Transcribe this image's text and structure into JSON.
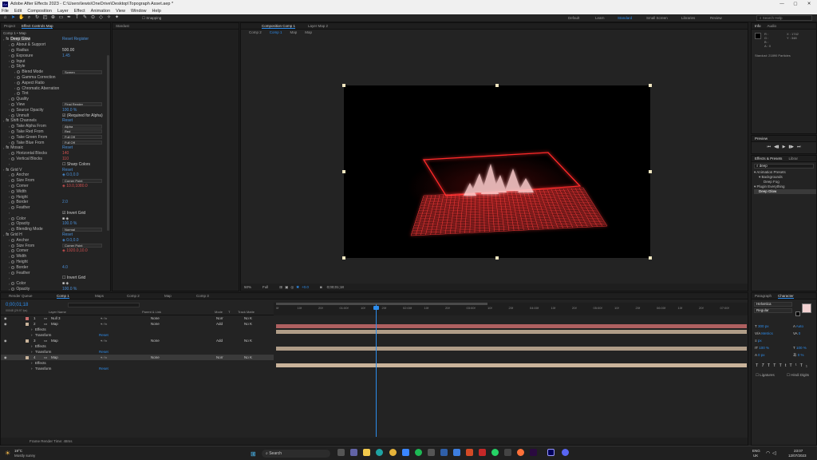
{
  "window": {
    "title": "Adobe After Effects 2023 - C:\\Users\\lewis\\OneDrive\\Desktop\\Topograph Asset.aep *",
    "controls": [
      "—",
      "▢",
      "✕"
    ]
  },
  "menu": [
    "File",
    "Edit",
    "Composition",
    "Layer",
    "Effect",
    "Animation",
    "View",
    "Window",
    "Help"
  ],
  "toolbar": {
    "snapping": "Snapping",
    "workspaces": [
      "Default",
      "Learn",
      "Standard",
      "Small Screen",
      "Libraries",
      "Review"
    ],
    "active_workspace": "Standard",
    "search_placeholder": "Search Help"
  },
  "effect_controls": {
    "tabs": [
      "Project",
      "Effect Controls Map",
      "Stardust"
    ],
    "header": "Comp 1 • Map",
    "rows": [
      {
        "i": 0,
        "fx": true,
        "n": "Deep Glow",
        "v": "Reset   Register",
        "c": "b"
      },
      {
        "i": 1,
        "n": "About & Support"
      },
      {
        "i": 1,
        "n": "Radius",
        "v": "500.00",
        "c": "w"
      },
      {
        "i": 1,
        "n": "Exposure",
        "v": "1.45",
        "c": "b"
      },
      {
        "i": 1,
        "n": "Input"
      },
      {
        "i": 1,
        "n": "Style"
      },
      {
        "i": 2,
        "n": "Blend Mode",
        "s": "Screen"
      },
      {
        "i": 2,
        "n": "Gamma Correction"
      },
      {
        "i": 2,
        "n": "Aspect Ratio"
      },
      {
        "i": 2,
        "n": "Chromatic Aberration"
      },
      {
        "i": 2,
        "n": "Tint"
      },
      {
        "i": 1,
        "n": "Quality"
      },
      {
        "i": 1,
        "n": "View",
        "s": "Final Render"
      },
      {
        "i": 1,
        "n": "Source Opacity",
        "v": "100.0 %",
        "c": "b"
      },
      {
        "i": 1,
        "n": "Unmult",
        "v": "☑ (Required for Alpha)",
        "c": "w"
      },
      {
        "i": 0,
        "fx": true,
        "n": "Shift Channels",
        "v": "Reset",
        "c": "b"
      },
      {
        "i": 1,
        "n": "Take Alpha From",
        "s": "Alpha"
      },
      {
        "i": 1,
        "n": "Take Red From",
        "s": "Red"
      },
      {
        "i": 1,
        "n": "Take Green From",
        "s": "Full Off"
      },
      {
        "i": 1,
        "n": "Take Blue From",
        "s": "Full Off"
      },
      {
        "i": 0,
        "fx": true,
        "n": "Mosaic",
        "v": "Reset",
        "c": "b"
      },
      {
        "i": 1,
        "n": "Horizontal Blocks",
        "v": "140",
        "c": "r"
      },
      {
        "i": 1,
        "n": "Vertical Blocks",
        "v": "110",
        "c": "r"
      },
      {
        "i": 1,
        "n": "",
        "v": "☐ Sharp Colors",
        "c": "w"
      },
      {
        "i": 0,
        "fx": true,
        "n": "Grid V",
        "v": "Reset",
        "c": "b"
      },
      {
        "i": 1,
        "n": "Anchor",
        "v": "◈ 0.0,0.0",
        "c": "b"
      },
      {
        "i": 1,
        "n": "Size From",
        "s": "Corner Point"
      },
      {
        "i": 1,
        "n": "Corner",
        "v": "◈ 10.0,1080.0",
        "c": "r"
      },
      {
        "i": 1,
        "n": "Width",
        "v": "",
        "c": "w"
      },
      {
        "i": 1,
        "n": "Height",
        "v": "",
        "c": "w"
      },
      {
        "i": 1,
        "n": "Border",
        "v": "2.0",
        "c": "b"
      },
      {
        "i": 1,
        "n": "Feather"
      },
      {
        "i": 1,
        "n": "",
        "v": "☑ Invert Grid",
        "c": "w"
      },
      {
        "i": 1,
        "n": "Color",
        "v": "■ ◈",
        "c": "w"
      },
      {
        "i": 1,
        "n": "Opacity",
        "v": "100.0 %",
        "c": "b"
      },
      {
        "i": 1,
        "n": "Blending Mode",
        "s": "Normal"
      },
      {
        "i": 0,
        "fx": true,
        "n": "Grid H",
        "v": "Reset",
        "c": "b"
      },
      {
        "i": 1,
        "n": "Anchor",
        "v": "◈ 0.0,0.0",
        "c": "b"
      },
      {
        "i": 1,
        "n": "Size From",
        "s": "Corner Point"
      },
      {
        "i": 1,
        "n": "Corner",
        "v": "◈ 1920.0,10.0",
        "c": "r"
      },
      {
        "i": 1,
        "n": "Width",
        "v": "",
        "c": "w"
      },
      {
        "i": 1,
        "n": "Height",
        "v": "",
        "c": "w"
      },
      {
        "i": 1,
        "n": "Border",
        "v": "4.0",
        "c": "b"
      },
      {
        "i": 1,
        "n": "Feather"
      },
      {
        "i": 1,
        "n": "",
        "v": "☐ Invert Grid",
        "c": "w"
      },
      {
        "i": 1,
        "n": "Color",
        "v": "■ ◈",
        "c": "w"
      },
      {
        "i": 1,
        "n": "Opacity",
        "v": "100.0 %",
        "c": "b"
      }
    ]
  },
  "stardust_tab": "Stardust",
  "composition": {
    "tabs": [
      "Composition Comp 1",
      "Layer Map 2"
    ],
    "breadcrumbs": [
      "Comp 2",
      "Comp 1",
      "Map",
      "Map"
    ],
    "zoom": "50%",
    "resolution": "Full",
    "timecode": "0;00;01;18",
    "offset": "+0.0"
  },
  "info": {
    "tabs": [
      "Info",
      "Audio"
    ],
    "values": [
      "R :",
      "G :",
      "B :",
      "A : 0"
    ],
    "coords": [
      "X : 1742",
      "Y : 348"
    ],
    "stardust": "Stardust: 21890 Particles"
  },
  "preview": {
    "title": "Preview",
    "controls": [
      "⏮",
      "◀▮",
      "▶",
      "▮▶",
      "⏭"
    ]
  },
  "effects_presets": {
    "tabs": [
      "Effects & Presets",
      "Librar"
    ],
    "search": "deep",
    "items": [
      {
        "d": 0,
        "t": "▾ Animation Presets"
      },
      {
        "d": 1,
        "t": "▾ Backgrounds"
      },
      {
        "d": 2,
        "t": "Deep Fog"
      },
      {
        "d": 0,
        "t": "▾ Plugin Everything"
      },
      {
        "d": 1,
        "t": "Deep Glow"
      }
    ]
  },
  "timeline": {
    "tabs": [
      "Render Queue",
      "Comp 1",
      "Maps",
      "Comp 2",
      "Map",
      "Comp 3"
    ],
    "active_tab": "Comp 1",
    "timecode": "0;00;01;18",
    "fps": "00048 (29.97 fps)",
    "headers": [
      "Layer Name",
      "Parent & Link",
      "Mode",
      "T",
      "Track Matte"
    ],
    "ruler": [
      "0f",
      "10f",
      "20f",
      "01:00f",
      "10f",
      "20f",
      "02:00f",
      "10f",
      "20f",
      "03:00f",
      "10f",
      "20f",
      "04:00f",
      "10f",
      "20f",
      "05:00f",
      "10f",
      "20f",
      "06:00f",
      "10f",
      "20f",
      "07:00f"
    ],
    "layers": [
      {
        "num": "1",
        "name": "Null 3",
        "parent": "None",
        "mode": "Norr",
        "matte": "No K",
        "color": "#c76b6b",
        "kind": "layer"
      },
      {
        "num": "2",
        "name": "Map",
        "parent": "None",
        "mode": "Add",
        "matte": "No K",
        "color": "#c9b39a",
        "kind": "layer"
      },
      {
        "name": "Effects",
        "kind": "sub",
        "v": ""
      },
      {
        "name": "Transform",
        "kind": "sub",
        "v": "Reset"
      },
      {
        "num": "3",
        "name": "Map",
        "parent": "None",
        "mode": "Add",
        "matte": "No K",
        "color": "#c9b39a",
        "kind": "layer"
      },
      {
        "name": "Effects",
        "kind": "sub",
        "v": ""
      },
      {
        "name": "Transform",
        "kind": "sub",
        "v": "Reset"
      },
      {
        "num": "4",
        "name": "Map",
        "parent": "None",
        "mode": "Norr",
        "matte": "No K",
        "color": "#c9b39a",
        "kind": "layer",
        "selected": true
      },
      {
        "name": "Effects",
        "kind": "sub",
        "v": ""
      },
      {
        "name": "Transform",
        "kind": "sub",
        "v": "Reset"
      }
    ],
    "footer": "Frame Render Time: 48ms"
  },
  "character": {
    "tabs": [
      "Paragraph",
      "Character"
    ],
    "font": "Helvetica",
    "style": "Regular",
    "size": "300 px",
    "leading": "Auto",
    "kerning": "Metrics",
    "tracking": "0",
    "unit": "px",
    "vscale": "100 %",
    "hscale": "100 %",
    "baseline": "0 px",
    "tsume": "0 %",
    "ligatures": "Ligatures",
    "hindi": "Hindi Digits"
  },
  "taskbar": {
    "weather_temp": "19°C",
    "weather_text": "Mostly sunny",
    "search": "Search",
    "lang": "ENG",
    "region": "UK",
    "time": "23:07",
    "date": "12/07/2023"
  },
  "colors": {
    "accent": "#2d8ceb",
    "red_glow": "#ff2a2a"
  }
}
